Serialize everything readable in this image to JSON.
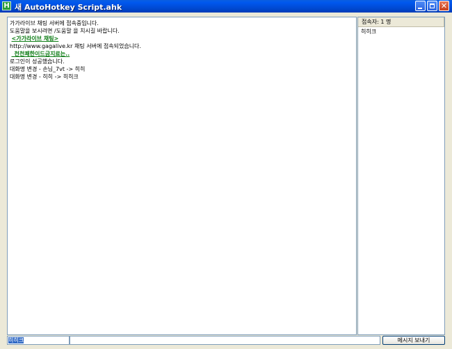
{
  "window": {
    "title": "새 AutoHotkey Script.ahk",
    "app_icon_letter": "H",
    "close_glyph": "✕"
  },
  "chat": {
    "lines": [
      {
        "text": "가가라이브 채팅 서버에 접속중입니다.",
        "link": false
      },
      {
        "text": "도움말을 보시려면 /도움말 을 치시길 바랍니다.",
        "link": false
      },
      {
        "text": "<가가라이브 채팅>",
        "link": true
      },
      {
        "text": "http://www.gagalive.kr 채팅 서버에 접속되었습니다.",
        "link": false
      },
      {
        "text": "_천천쾌한이드금지료는..",
        "link": true
      },
      {
        "text": "로그인이 성공했습니다.",
        "link": false
      },
      {
        "text": "대화명 변경 - 손님_7vt -> 히히",
        "link": false
      },
      {
        "text": "대화명 변경 - 히히 -> 히히크",
        "link": false
      }
    ]
  },
  "users": {
    "header": "접속자: 1 명",
    "list": [
      "히히크"
    ]
  },
  "bottom": {
    "nickname": "히히크",
    "message_value": "",
    "send_label": "메시지 보내기"
  },
  "colors": {
    "titlebar": "#0058ee",
    "link": "#0a7a12",
    "window_bg": "#ece9d8"
  }
}
